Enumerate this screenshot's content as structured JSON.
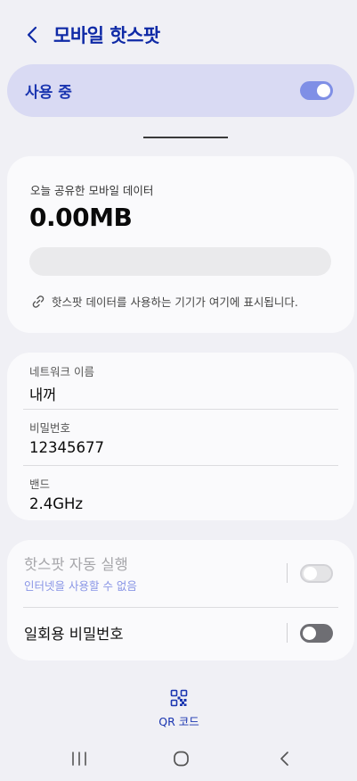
{
  "header": {
    "title": "모바일 핫스팟"
  },
  "master_switch": {
    "label": "사용 중",
    "on": true
  },
  "usage": {
    "caption": "오늘 공유한 모바일 데이터",
    "value": "0.00MB",
    "fill_fraction": 0,
    "hint": "핫스팟 데이터를 사용하는 기기가 여기에 표시됩니다."
  },
  "network": {
    "rows": [
      {
        "label": "네트워크 이름",
        "value": "내꺼"
      },
      {
        "label": "비밀번호",
        "value": "12345677"
      },
      {
        "label": "밴드",
        "value": "2.4GHz"
      }
    ]
  },
  "options": {
    "auto_hotspot": {
      "title": "핫스팟 자동 실행",
      "subtitle": "인터넷을 사용할 수 없음",
      "on": false,
      "enabled": false
    },
    "one_time_password": {
      "title": "일회용 비밀번호",
      "on": false,
      "enabled": true
    }
  },
  "qr": {
    "label": "QR 코드"
  },
  "colors": {
    "accent": "#1a35b0",
    "toggle_on": "#7f8fe6",
    "master_bg": "#d9daf3"
  }
}
